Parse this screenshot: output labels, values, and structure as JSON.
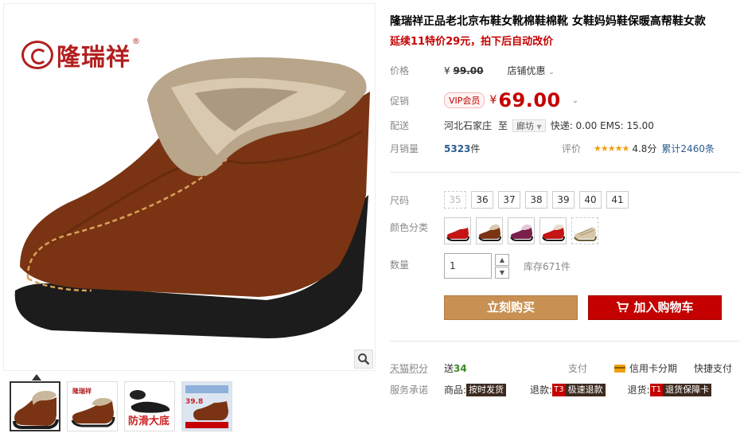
{
  "brand": {
    "name": "隆瑞祥",
    "reg_mark": "®"
  },
  "gallery": {
    "thumbs": [
      {
        "id": "thumb-1"
      },
      {
        "id": "thumb-2",
        "logo": "隆瑞祥"
      },
      {
        "id": "thumb-3",
        "caption": "防滑大底"
      },
      {
        "id": "thumb-4",
        "caption": "39.8"
      }
    ]
  },
  "product": {
    "title": "隆瑞祥正品老北京布鞋女靴棉鞋棉靴 女鞋妈妈鞋保暖高帮鞋女款",
    "subtitle": "延续11特价29元，拍下后自动改价"
  },
  "pricing": {
    "price_label": "价格",
    "old_price_yen": "¥",
    "old_price": "99.00",
    "promo_dropdown": "店铺优惠",
    "promo_label": "促销",
    "vip_badge": "VIP会员",
    "price_yen": "¥",
    "price": "69.00"
  },
  "shipping": {
    "label": "配送",
    "from": "河北石家庄",
    "to_word": "至",
    "destination": "廊坊",
    "fee": "快递: 0.00 EMS: 15.00"
  },
  "sales": {
    "label": "月销量",
    "count": "5323",
    "unit": "件",
    "rating_label": "评价",
    "stars": "★★★★★",
    "score": "4.8分",
    "reviews": "累计2460条"
  },
  "options": {
    "size_label": "尺码",
    "sizes": [
      "35",
      "36",
      "37",
      "38",
      "39",
      "40",
      "41"
    ],
    "color_label": "颜色分类",
    "quantity_label": "数量",
    "quantity_value": "1",
    "stock": "库存671件"
  },
  "actions": {
    "buy_now": "立刻购买",
    "add_cart": "加入购物车"
  },
  "footer": {
    "points_label": "天猫积分",
    "points_prefix": "送",
    "points_value": "34",
    "pay_label": "支付",
    "installment": "信用卡分期",
    "quick_pay": "快捷支付",
    "service_label": "服务承诺",
    "goods_label": "商品:",
    "goods_tag": "按时发货",
    "refund_label": "退款:",
    "refund_t": "T3",
    "refund_tag": "极速退款",
    "return_label": "退货:",
    "return_t": "T1",
    "return_tag": "退货保障卡"
  },
  "colors": {
    "accent": "#c40000",
    "buy": "#c89052",
    "link": "#2a5d8f"
  }
}
